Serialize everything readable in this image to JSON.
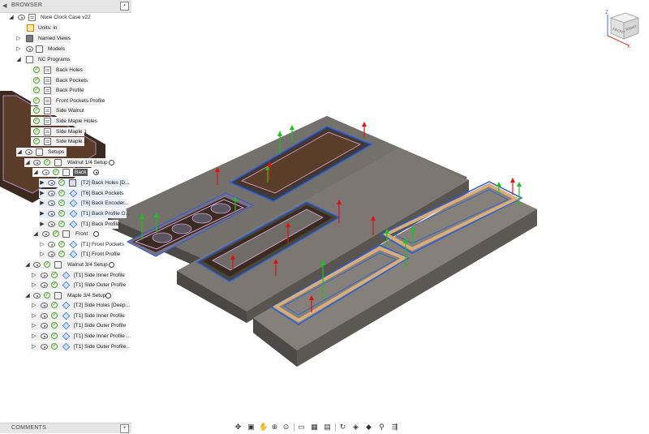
{
  "browser": {
    "title": "BROWSER",
    "document_name": "Nixie Clock Case v22",
    "units_label": "Units: in",
    "named_views": "Named Views",
    "models": "Models",
    "nc_programs": "NC Programs",
    "nc_items": [
      "Back Holes",
      "Back Pockets",
      "Back Profile",
      "Front Pockets Profile",
      "Side Walnut",
      "Side Maple Holes",
      "Side Maple 1",
      "Side Maple 2"
    ],
    "setups": "Setups",
    "walnut_quarter_setup": "Walnut 1/4 Setup",
    "back_folder": "Back",
    "back_ops": [
      "[T2] Back Holes [D...",
      "[T6] Back Pockets",
      "[T6] Back Encoder...",
      "[T1] Back Profile O...",
      "[T1] Back Profile"
    ],
    "front_folder": "Front",
    "front_ops": [
      "[T1] Front Pockets",
      "[T1] Front Profile"
    ],
    "walnut_34_setup": "Walnut 3/4 Setup",
    "walnut_34_ops": [
      "[T1] Side Inner Profile",
      "[T1] Side Outer Profile"
    ],
    "maple_34_setup": "Maple 3/4 Setup",
    "maple_34_ops": [
      "[T2] Side Holes [Deep...",
      "[T1] Side Inner Profile",
      "[T1] Side Outer Profile",
      "[T1] Side Inner Profile ...",
      "[T1] Side Outer Profile..."
    ]
  },
  "comments": {
    "title": "COMMENTS"
  },
  "viewcube": {
    "front": "FRONT",
    "right": "RIGHT",
    "z_axis": "Z",
    "x_axis": "X"
  },
  "navbar": {
    "icons": [
      "orbit-icon",
      "look-at-icon",
      "pan-icon",
      "zoom-icon",
      "fit-icon",
      "display-settings-icon",
      "grid-icon",
      "viewports-icon",
      "simulate-icon",
      "sections-icon",
      "stock-icon",
      "tool-icon",
      "toolpath-icon"
    ]
  },
  "colors": {
    "panel_bg": "#f0f0f0",
    "header_bg": "#e6e6e6",
    "stock_gray": "#6e6a66",
    "walnut": "#4a3222",
    "maple": "#d9ad7c",
    "toolpath_blue": "#2b5fd6",
    "toolpath_pink": "#d2a6d8",
    "marker_green": "#20c020",
    "marker_red": "#e01010"
  }
}
